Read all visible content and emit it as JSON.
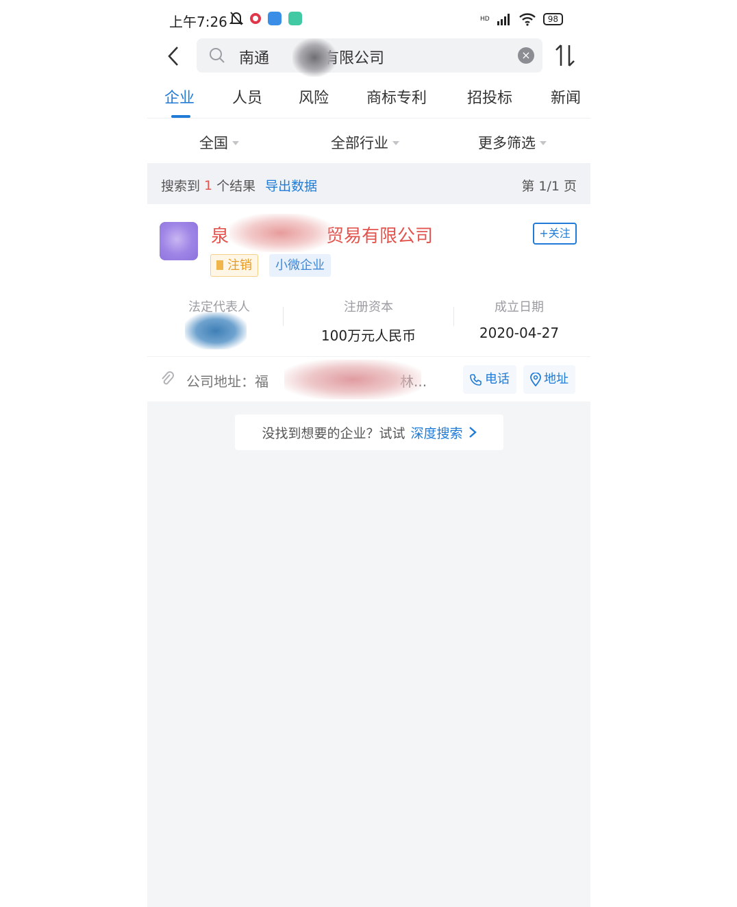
{
  "status_bar": {
    "time": "上午7:26",
    "network": "HD",
    "battery": "98"
  },
  "search": {
    "query": "南通",
    "query_suffix": "易有限公司"
  },
  "tabs": [
    {
      "label": "企业",
      "active": true
    },
    {
      "label": "人员",
      "active": false
    },
    {
      "label": "风险",
      "active": false
    },
    {
      "label": "商标专利",
      "active": false
    },
    {
      "label": "招投标",
      "active": false
    },
    {
      "label": "新闻",
      "active": false
    }
  ],
  "filters": [
    {
      "label": "全国"
    },
    {
      "label": "全部行业"
    },
    {
      "label": "更多筛选"
    }
  ],
  "results": {
    "prefix": "搜索到",
    "count": "1",
    "suffix": "个结果",
    "export_label": "导出数据",
    "page_label": "第 1/1 页"
  },
  "company": {
    "name_start": "泉",
    "name_end": "贸易有限公司",
    "follow_label": "+关注",
    "tags": [
      {
        "label": "注销",
        "type": "cancelled"
      },
      {
        "label": "小微企业",
        "type": "small"
      }
    ],
    "info": [
      {
        "label": "法定代表人",
        "value": ""
      },
      {
        "label": "注册资本",
        "value": "100万元人民币"
      },
      {
        "label": "成立日期",
        "value": "2020-04-27"
      }
    ],
    "address_label": "公司地址：福",
    "address_end": "林...",
    "phone_label": "电话",
    "address_button_label": "地址"
  },
  "deep_search": {
    "prompt": "没找到想要的企业？试试",
    "link": "深度搜索"
  },
  "colors": {
    "accent": "#1f7bd6",
    "company_name": "#e2544e",
    "cancelled_tag": "#e79a23"
  }
}
